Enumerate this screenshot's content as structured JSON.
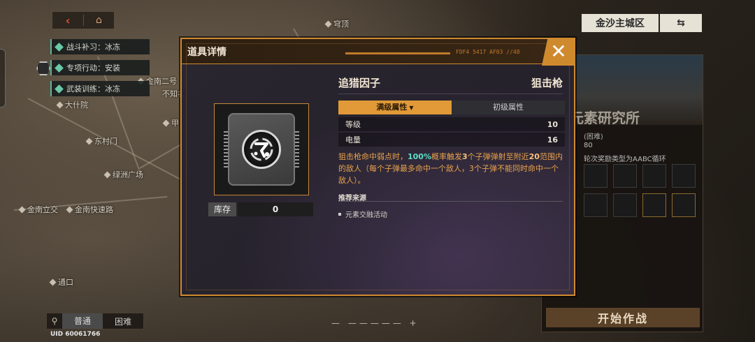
{
  "map": {
    "labels": [
      "穹顶",
      "大什院",
      "东村门",
      "金南二号",
      "不知名前路",
      "绿洲广场",
      "金南立交",
      "金南快速路",
      "通口",
      "甲"
    ],
    "nav": {
      "back_icon": "back-icon",
      "home_icon": "home-icon"
    },
    "tasks": [
      {
        "label": "战斗补习：冰冻"
      },
      {
        "label": "专项行动：安装"
      },
      {
        "label": "武装训练：冰冻"
      }
    ],
    "difficulty": {
      "normal": "普通",
      "hard": "困难"
    },
    "uid": "UID 60061766"
  },
  "region": {
    "name": "金沙主城区"
  },
  "right_panel": {
    "title": "元素研究所",
    "line1": "(困难)",
    "line2": "80",
    "line3": "轮次奖励类型为AABC循环",
    "start_label": "开始作战"
  },
  "dialog": {
    "title": "道具详情",
    "code": "FDF4 5417 AF03 //48",
    "item": {
      "name": "追猎因子",
      "type": "狙击枪",
      "stock_label": "库存",
      "stock_value": "0"
    },
    "tabs": {
      "active": "满级属性",
      "inactive": "初级属性"
    },
    "stats": [
      {
        "label": "等级",
        "value": "10"
      },
      {
        "label": "电量",
        "value": "16"
      }
    ],
    "description": {
      "p1": "狙击枪命中弱点时，",
      "p2": "100%",
      "p3": "概率触发",
      "p4": "3",
      "p5": "个子弹弹射至附近",
      "p6": "20",
      "p7": "范围内的敌人（每个子弹最多命中一个敌人，3个子弹不能同时命中一个敌人）。"
    },
    "source": {
      "heading": "推荐来源",
      "item": "元素交融活动"
    }
  },
  "colors": {
    "accent": "#d08a2e",
    "highlight": "#5ee0c8",
    "text_orange": "#e9a24b"
  }
}
